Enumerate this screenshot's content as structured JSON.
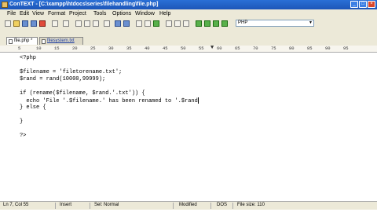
{
  "window": {
    "title": "ConTEXT - [C:\\xampp\\htdocs\\series\\filehandling\\file.php]",
    "minimize": "_",
    "maximize": "□",
    "close": "×"
  },
  "menu": [
    "File",
    "Edit",
    "View",
    "Format",
    "Project",
    "Tools",
    "Options",
    "Window",
    "Help"
  ],
  "toolbar": {
    "language": "PHP"
  },
  "tabs": [
    {
      "label": "file.php *",
      "active": true
    },
    {
      "label": "filesystem.txt",
      "active": false
    }
  ],
  "ruler": [
    "5",
    "10",
    "15",
    "20",
    "25",
    "30",
    "35",
    "40",
    "45",
    "50",
    "55",
    "60",
    "65",
    "70",
    "75",
    "80",
    "85",
    "90",
    "95"
  ],
  "code": [
    "<?php",
    "",
    "$filename = 'filetorename.txt';",
    "$rand = rand(10000,99999);",
    "",
    "if (rename($filename, $rand.'.txt')) {",
    "  echo 'File '.$filename.' has been renamed to '.$rand",
    "} else {",
    "",
    "}",
    "",
    "?>"
  ],
  "status": {
    "position": "Ln 7, Col 55",
    "mode": "Insert",
    "selection": "Sel: Normal",
    "modified": "Modified",
    "format": "DOS",
    "filesize": "File size: 110"
  }
}
